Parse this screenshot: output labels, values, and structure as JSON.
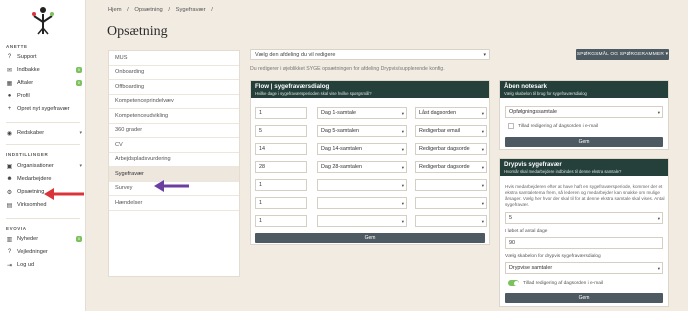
{
  "sidebar": {
    "section_anette": "ANETTE",
    "items_top": [
      {
        "label": "Support",
        "icon": "question-icon"
      },
      {
        "label": "Indbakke",
        "icon": "inbox-icon",
        "badge": "0"
      },
      {
        "label": "Aftaler",
        "icon": "calendar-icon",
        "badge": "0"
      },
      {
        "label": "Profil",
        "icon": "user-icon"
      },
      {
        "label": "Opret nyt sygefravær",
        "icon": "plus-icon"
      }
    ],
    "redskaber": "Redskaber",
    "section_settings": "INDSTILLINGER",
    "items_settings": [
      {
        "label": "Organisationer",
        "icon": "building-icon"
      },
      {
        "label": "Medarbejdere",
        "icon": "users-icon"
      },
      {
        "label": "Opsætning",
        "icon": "gear-icon"
      },
      {
        "label": "Virksomhed",
        "icon": "briefcase-icon"
      }
    ],
    "section_evovia": "EVOVIA",
    "items_evovia": [
      {
        "label": "Nyheder",
        "icon": "news-icon",
        "badge": "0"
      },
      {
        "label": "Vejledninger",
        "icon": "help-icon"
      },
      {
        "label": "Log ud",
        "icon": "logout-icon"
      }
    ]
  },
  "breadcrumb": [
    "Hjem",
    "/",
    "Opsætning",
    "/",
    "Sygefravær",
    "/"
  ],
  "page_title": "Opsætning",
  "menu": [
    "MUS",
    "Onboarding",
    "Offboarding",
    "Kompetenceprindelvæv",
    "Kompetenceudvikling",
    "360 grader",
    "CV",
    "Arbejdspladsvurdering",
    "Sygefravær",
    "Survey",
    "Hændelser"
  ],
  "menu_active": "Sygefravær",
  "dept_select": "Vælg den afdeling du vil redigere",
  "info_text": "Du redigerer i øjeblikket SYGE opsætningen for afdeling Drypvis/supplerende konfig.",
  "qa_button": "SPØRGSMÅL OG SPØRGERAMMER",
  "flow": {
    "title": "Flow | sygefraværsdialog",
    "subtitle": "Hvilke dage i sygefraværsperioden skal vise hvilke spørgsmål?",
    "rows": [
      {
        "day": "1",
        "template": "Dag 1-samtale",
        "action": "Låst dagsorden"
      },
      {
        "day": "5",
        "template": "Dag 5-samtalen",
        "action": "Redigerbar email"
      },
      {
        "day": "14",
        "template": "Dag 14-samtalen",
        "action": "Redigerbar dagsorde"
      },
      {
        "day": "28",
        "template": "Dag 28-samtalen",
        "action": "Redigerbar dagsorde"
      },
      {
        "day": "1",
        "template": "",
        "action": ""
      },
      {
        "day": "1",
        "template": "",
        "action": ""
      },
      {
        "day": "1",
        "template": "",
        "action": ""
      }
    ],
    "save": "Gem"
  },
  "note": {
    "title": "Åben notesark",
    "subtitle": "Vælg skabelon til brug for sygefraværsdialog",
    "select": "Opfølgningssamtale",
    "checkbox": "Tillad redigering af dagsorden i e-mail",
    "save": "Gem"
  },
  "drypvis": {
    "title": "Drypvis sygefravær",
    "subtitle": "Hvornår skal medarbejdere indbindes til denne ekstra samtale?",
    "description": "Hvis medarbejderen efter at have haft en sygefraværsperiode, kommer der et ekstra samtaletema frem, så lederen og medarbejder kan snakke om mulige årsager. Vælg her hvor der skal til for at denne ekstra samtale skal vises. Antal sygefravær.",
    "count_label": "Antal sygefravær",
    "count_value": "5",
    "days_label": "I løbet af antal dage",
    "days_value": "90",
    "template_label": "Vælg skabelon for drypvis sygefraværsdialog",
    "template_value": "Drypvise samtaler",
    "toggle_label": "Tillad redigering af dagsorden i e-mail",
    "save": "Gem"
  },
  "colors": {
    "panel_header": "#25403b",
    "button": "#4e5a61",
    "badge": "#7cc15d",
    "arrow_red": "#d9343a",
    "arrow_purple": "#6b3fa0",
    "background": "#f1ebe2"
  }
}
